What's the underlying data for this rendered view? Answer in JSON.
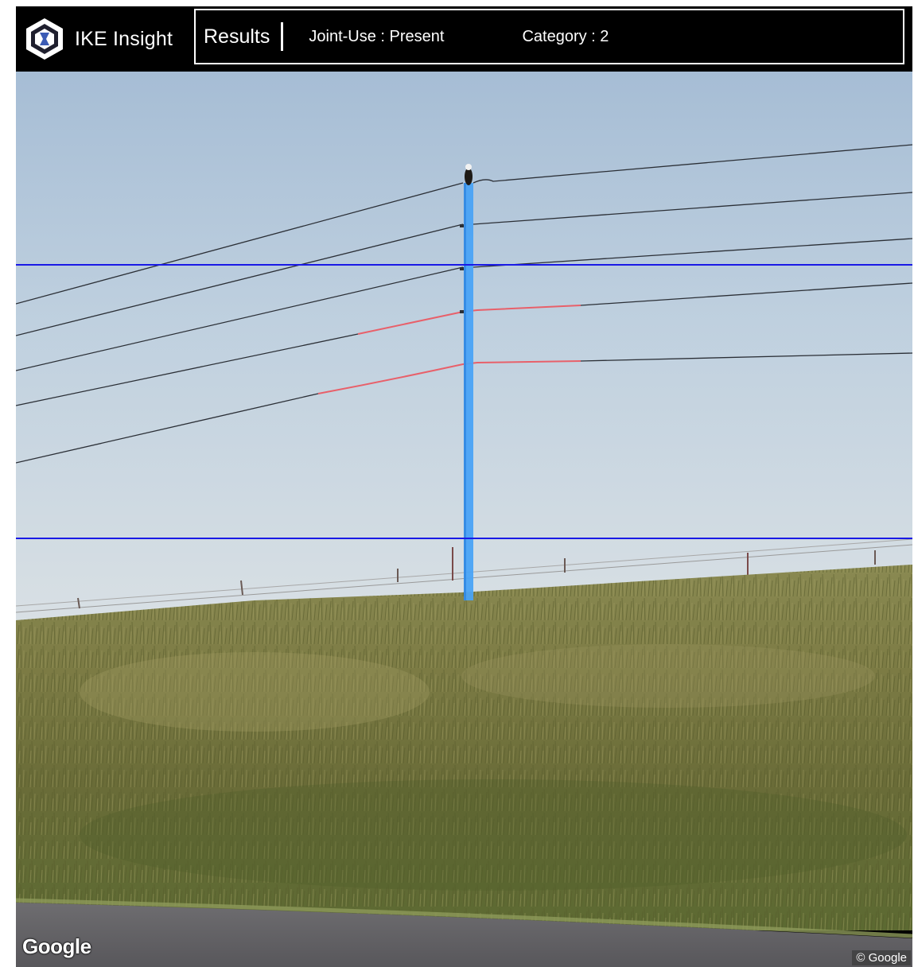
{
  "app": {
    "name": "IKE Insight"
  },
  "results": {
    "title": "Results",
    "joint_use": "Joint-Use : Present",
    "category": "Category : 2"
  },
  "map": {
    "provider_logo": "Google",
    "copyright": "© Google"
  },
  "colors": {
    "pole_highlight": "#4aa3f5",
    "reference_line": "#1a1ae6",
    "attachment_highlight": "#e8606a"
  },
  "icons": {
    "brand_logo": "ike-logo-icon"
  }
}
